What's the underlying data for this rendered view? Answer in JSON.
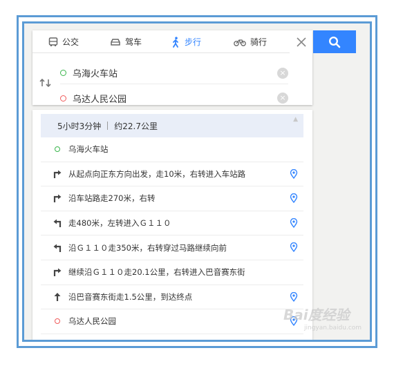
{
  "tabs": [
    {
      "label": "公交",
      "icon": "bus-icon"
    },
    {
      "label": "驾车",
      "icon": "car-icon"
    },
    {
      "label": "步行",
      "icon": "walk-icon",
      "active": true
    },
    {
      "label": "骑行",
      "icon": "bike-icon"
    }
  ],
  "route": {
    "origin": "乌海火车站",
    "destination": "乌达人民公园"
  },
  "summary": {
    "duration": "5小时3分钟",
    "distance": "约22.7公里"
  },
  "steps": [
    {
      "text": "乌海火车站",
      "icon": "origin-dot-icon"
    },
    {
      "text": "从起点向正东方向出发，走10米，右转进入车站路",
      "icon": "turn-right-icon"
    },
    {
      "text": "沿车站路走270米，右转",
      "icon": "turn-right-icon"
    },
    {
      "text": "走480米，左转进入Ｇ１１０",
      "icon": "turn-left-icon"
    },
    {
      "text": "沿Ｇ１１０走350米，右转穿过马路继续向前",
      "icon": "turn-left-icon"
    },
    {
      "text": "继续沿Ｇ１１０走20.1公里，右转进入巴音赛东街",
      "icon": "turn-right-icon"
    },
    {
      "text": "沿巴音赛东街走1.5公里，到达终点",
      "icon": "straight-arrow-icon"
    },
    {
      "text": "乌达人民公园",
      "icon": "destination-dot-icon"
    }
  ],
  "colors": {
    "accent": "#3385ff",
    "frame": "#5b9bd5",
    "origin": "#38b54a",
    "destination": "#f05a5a"
  },
  "watermark": {
    "text": "Bai度经验",
    "sub": "jingyan.baidu.com"
  }
}
